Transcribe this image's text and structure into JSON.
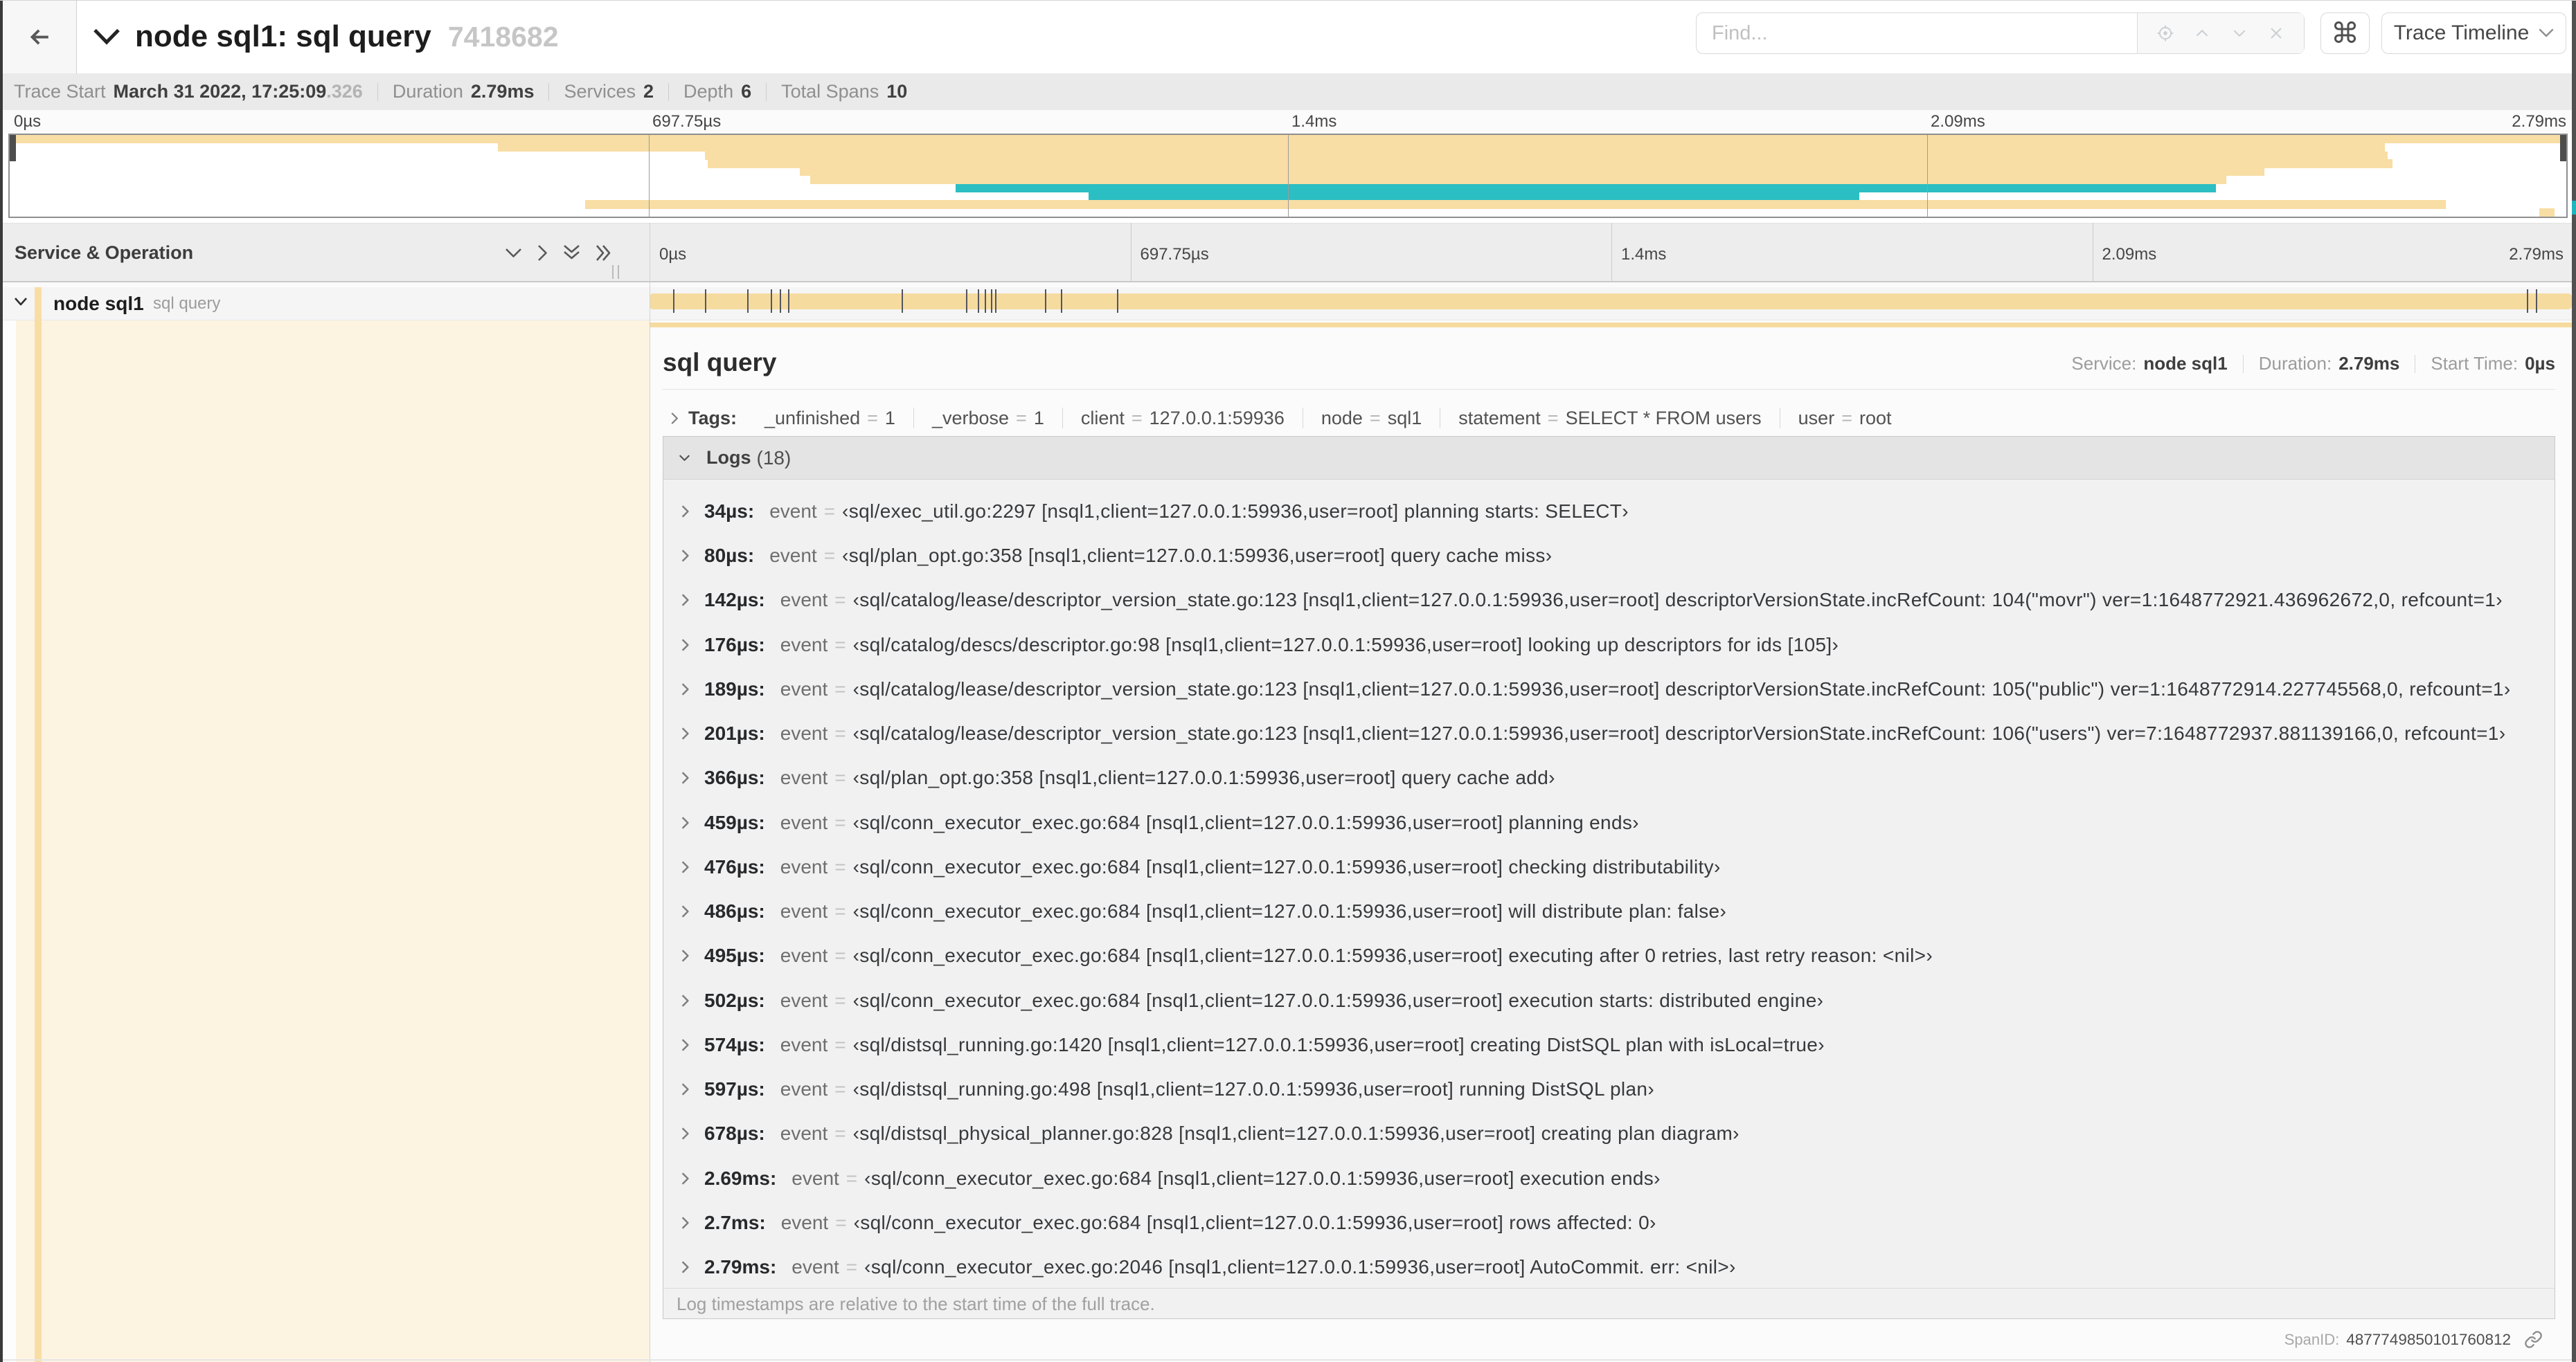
{
  "header": {
    "title": "node sql1: sql query",
    "trace_id": "7418682",
    "find_placeholder": "Find...",
    "cmd_key": "⌘",
    "view_selector": "Trace Timeline"
  },
  "summary": {
    "items": [
      {
        "label": "Trace Start",
        "value": "March 31 2022, 17:25:09",
        "suffix": ".326"
      },
      {
        "label": "Duration",
        "value": "2.79ms"
      },
      {
        "label": "Services",
        "value": "2"
      },
      {
        "label": "Depth",
        "value": "6"
      },
      {
        "label": "Total Spans",
        "value": "10"
      }
    ]
  },
  "chart_data": {
    "type": "gantt-minimap",
    "title": "trace span overview minimap",
    "axis_ticks": [
      "0µs",
      "697.75µs",
      "1.4ms",
      "2.09ms",
      "2.79ms"
    ],
    "axis_tick_fractions": [
      0,
      0.25,
      0.5,
      0.75,
      1
    ],
    "duration_us": 2790,
    "colors": {
      "service_tan": "#F8DDA4",
      "service_teal": "#2BBEC2"
    },
    "spans": [
      {
        "row": 1,
        "start": 0.0,
        "end": 1.0,
        "color": "#F8DDA4"
      },
      {
        "row": 2,
        "start": 0.191,
        "end": 0.929,
        "color": "#F8DDA4"
      },
      {
        "row": 3,
        "start": 0.272,
        "end": 0.93,
        "color": "#F8DDA4"
      },
      {
        "row": 4,
        "start": 0.273,
        "end": 0.932,
        "color": "#F8DDA4"
      },
      {
        "row": 5,
        "start": 0.309,
        "end": 0.882,
        "color": "#F8DDA4"
      },
      {
        "row": 6,
        "start": 0.313,
        "end": 0.867,
        "color": "#F8DDA4"
      },
      {
        "row": 7,
        "start": 0.37,
        "end": 0.863,
        "color": "#2BBEC2"
      },
      {
        "row": 8,
        "start": 0.422,
        "end": 0.7235,
        "color": "#2BBEC2"
      },
      {
        "row": 9,
        "start": 0.225,
        "end": 0.9528,
        "color": "#F8DDA4"
      },
      {
        "row": 10,
        "start": 0.9895,
        "end": 0.9955,
        "color": "#F8DDA4"
      }
    ]
  },
  "timeline": {
    "left_header": "Service & Operation",
    "ruler_ticks": [
      "0µs",
      "697.75µs",
      "1.4ms",
      "2.09ms",
      "2.79ms"
    ],
    "row": {
      "service": "node sql1",
      "operation": "sql query",
      "bar_color": "#F6DB9F",
      "duration_us": 2790,
      "log_marker_times_us": [
        34,
        80,
        142,
        176,
        189,
        201,
        366,
        459,
        476,
        486,
        495,
        502,
        574,
        597,
        678,
        2725,
        2738
      ]
    }
  },
  "detail": {
    "title": "sql query",
    "meta": [
      {
        "label": "Service:",
        "value": "node sql1"
      },
      {
        "label": "Duration:",
        "value": "2.79ms"
      },
      {
        "label": "Start Time:",
        "value": "0µs"
      }
    ],
    "tags_label": "Tags:",
    "tags": [
      {
        "key": "_unfinished",
        "value": "1"
      },
      {
        "key": "_verbose",
        "value": "1"
      },
      {
        "key": "client",
        "value": "127.0.0.1:59936"
      },
      {
        "key": "node",
        "value": "sql1"
      },
      {
        "key": "statement",
        "value": "SELECT * FROM users"
      },
      {
        "key": "user",
        "value": "root"
      }
    ],
    "logs_label": "Logs",
    "logs_count": "(18)",
    "logs": [
      {
        "ts": "34µs:",
        "key": "event",
        "value": "‹sql/exec_util.go:2297 [nsql1,client=127.0.0.1:59936,user=root] planning starts: SELECT›"
      },
      {
        "ts": "80µs:",
        "key": "event",
        "value": "‹sql/plan_opt.go:358 [nsql1,client=127.0.0.1:59936,user=root] query cache miss›"
      },
      {
        "ts": "142µs:",
        "key": "event",
        "value": "‹sql/catalog/lease/descriptor_version_state.go:123 [nsql1,client=127.0.0.1:59936,user=root] descriptorVersionState.incRefCount: 104(\"movr\") ver=1:1648772921.436962672,0, refcount=1›"
      },
      {
        "ts": "176µs:",
        "key": "event",
        "value": "‹sql/catalog/descs/descriptor.go:98 [nsql1,client=127.0.0.1:59936,user=root] looking up descriptors for ids [105]›"
      },
      {
        "ts": "189µs:",
        "key": "event",
        "value": "‹sql/catalog/lease/descriptor_version_state.go:123 [nsql1,client=127.0.0.1:59936,user=root] descriptorVersionState.incRefCount: 105(\"public\") ver=1:1648772914.227745568,0, refcount=1›"
      },
      {
        "ts": "201µs:",
        "key": "event",
        "value": "‹sql/catalog/lease/descriptor_version_state.go:123 [nsql1,client=127.0.0.1:59936,user=root] descriptorVersionState.incRefCount: 106(\"users\") ver=7:1648772937.881139166,0, refcount=1›"
      },
      {
        "ts": "366µs:",
        "key": "event",
        "value": "‹sql/plan_opt.go:358 [nsql1,client=127.0.0.1:59936,user=root] query cache add›"
      },
      {
        "ts": "459µs:",
        "key": "event",
        "value": "‹sql/conn_executor_exec.go:684 [nsql1,client=127.0.0.1:59936,user=root] planning ends›"
      },
      {
        "ts": "476µs:",
        "key": "event",
        "value": "‹sql/conn_executor_exec.go:684 [nsql1,client=127.0.0.1:59936,user=root] checking distributability›"
      },
      {
        "ts": "486µs:",
        "key": "event",
        "value": "‹sql/conn_executor_exec.go:684 [nsql1,client=127.0.0.1:59936,user=root] will distribute plan: false›"
      },
      {
        "ts": "495µs:",
        "key": "event",
        "value": "‹sql/conn_executor_exec.go:684 [nsql1,client=127.0.0.1:59936,user=root] executing after 0 retries, last retry reason: <nil>›"
      },
      {
        "ts": "502µs:",
        "key": "event",
        "value": "‹sql/conn_executor_exec.go:684 [nsql1,client=127.0.0.1:59936,user=root] execution starts: distributed engine›"
      },
      {
        "ts": "574µs:",
        "key": "event",
        "value": "‹sql/distsql_running.go:1420 [nsql1,client=127.0.0.1:59936,user=root] creating DistSQL plan with isLocal=true›"
      },
      {
        "ts": "597µs:",
        "key": "event",
        "value": "‹sql/distsql_running.go:498 [nsql1,client=127.0.0.1:59936,user=root] running DistSQL plan›"
      },
      {
        "ts": "678µs:",
        "key": "event",
        "value": "‹sql/distsql_physical_planner.go:828 [nsql1,client=127.0.0.1:59936,user=root] creating plan diagram›"
      },
      {
        "ts": "2.69ms:",
        "key": "event",
        "value": "‹sql/conn_executor_exec.go:684 [nsql1,client=127.0.0.1:59936,user=root] execution ends›"
      },
      {
        "ts": "2.7ms:",
        "key": "event",
        "value": "‹sql/conn_executor_exec.go:684 [nsql1,client=127.0.0.1:59936,user=root] rows affected: 0›"
      },
      {
        "ts": "2.79ms:",
        "key": "event",
        "value": "‹sql/conn_executor_exec.go:2046 [nsql1,client=127.0.0.1:59936,user=root] AutoCommit. err: <nil>›"
      }
    ],
    "logs_footer": "Log timestamps are relative to the start time of the full trace.",
    "spanid_label": "SpanID:",
    "spanid_value": "4877749850101760812"
  }
}
